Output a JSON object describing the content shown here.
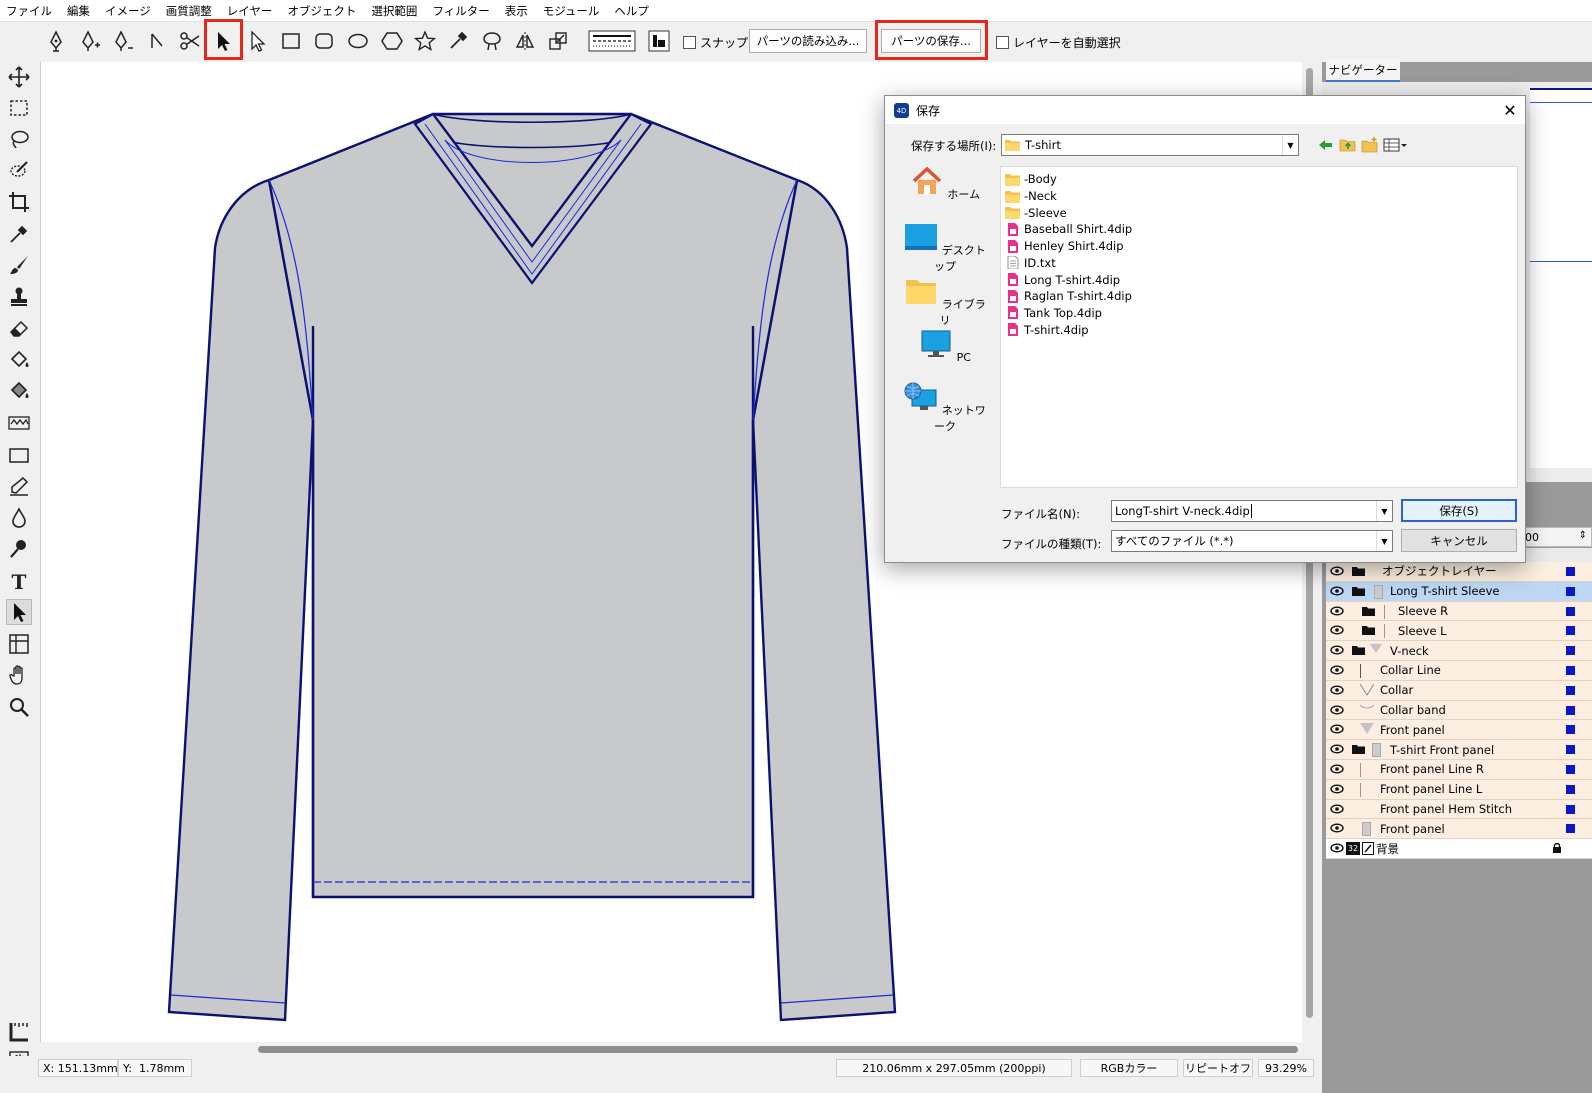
{
  "menu": [
    "ファイル",
    "編集",
    "イメージ",
    "画質調整",
    "レイヤー",
    "オブジェクト",
    "選択範囲",
    "フィルター",
    "表示",
    "モジュール",
    "ヘルプ"
  ],
  "toolbar": {
    "snap_label": "スナップ",
    "load_parts_label": "パーツの読み込み...",
    "save_parts_label": "パーツの保存...",
    "auto_select_label": "レイヤーを自動選択",
    "highlight_color": "#e8261a"
  },
  "navigator": {
    "tab_label": "ナビゲーター",
    "zoom_value": "00"
  },
  "layers": [
    {
      "name": "オブジェクトレイヤー",
      "indent": 0,
      "folder": true,
      "selected": false
    },
    {
      "name": "Long T-shirt Sleeve",
      "indent": 0,
      "folder": true,
      "selected": true
    },
    {
      "name": "Sleeve R",
      "indent": 1,
      "folder": true,
      "selected": false
    },
    {
      "name": "Sleeve L",
      "indent": 1,
      "folder": true,
      "selected": false
    },
    {
      "name": "V-neck",
      "indent": 0,
      "folder": true,
      "selected": false
    },
    {
      "name": "Collar Line",
      "indent": 1,
      "folder": false,
      "selected": false
    },
    {
      "name": "Collar",
      "indent": 1,
      "folder": false,
      "selected": false
    },
    {
      "name": "Collar band",
      "indent": 1,
      "folder": false,
      "selected": false
    },
    {
      "name": "Front panel",
      "indent": 1,
      "folder": false,
      "selected": false
    },
    {
      "name": "T-shirt Front panel",
      "indent": 0,
      "folder": true,
      "selected": false
    },
    {
      "name": "Front panel Line R",
      "indent": 1,
      "folder": false,
      "selected": false
    },
    {
      "name": "Front panel Line L",
      "indent": 1,
      "folder": false,
      "selected": false
    },
    {
      "name": "Front panel Hem Stitch",
      "indent": 1,
      "folder": false,
      "selected": false
    },
    {
      "name": "Front panel",
      "indent": 1,
      "folder": false,
      "selected": false
    }
  ],
  "background_layer": {
    "name": "背景",
    "badge": "32"
  },
  "dialog": {
    "title": "保存",
    "app_badge": "4D",
    "location_label": "保存する場所(I):",
    "location_value": "T-shirt",
    "places": [
      "ホーム",
      "デスクトップ",
      "ライブラリ",
      "PC",
      "ネットワーク"
    ],
    "files": [
      {
        "name": "-Body",
        "type": "folder"
      },
      {
        "name": "-Neck",
        "type": "folder"
      },
      {
        "name": "-Sleeve",
        "type": "folder"
      },
      {
        "name": "Baseball Shirt.4dip",
        "type": "doc"
      },
      {
        "name": "Henley Shirt.4dip",
        "type": "doc"
      },
      {
        "name": "ID.txt",
        "type": "txt"
      },
      {
        "name": "Long T-shirt.4dip",
        "type": "doc"
      },
      {
        "name": "Raglan T-shirt.4dip",
        "type": "doc"
      },
      {
        "name": "Tank Top.4dip",
        "type": "doc"
      },
      {
        "name": "T-shirt.4dip",
        "type": "doc"
      }
    ],
    "filename_label": "ファイル名(N):",
    "filename_value": "LongT-shirt V-neck.4dip",
    "filetype_label": "ファイルの種類(T):",
    "filetype_value": "すべてのファイル (*.*)",
    "save_button": "保存(S)",
    "cancel_button": "キャンセル"
  },
  "status": {
    "x_label": "X:",
    "x_value": "151.13mm",
    "y_label": "Y:",
    "y_value": "1.78mm",
    "doc_size": "210.06mm x 297.05mm (200ppi)",
    "color_mode": "RGBカラー",
    "repeat": "リピートオフ",
    "zoom": "93.29%"
  },
  "colors": {
    "garment_fill": "#c8c9cb",
    "outline": "#0a1170",
    "stitch": "#1c2ad8",
    "layer_bg": "#fcefe1",
    "layer_selected": "#bcd6f4"
  }
}
